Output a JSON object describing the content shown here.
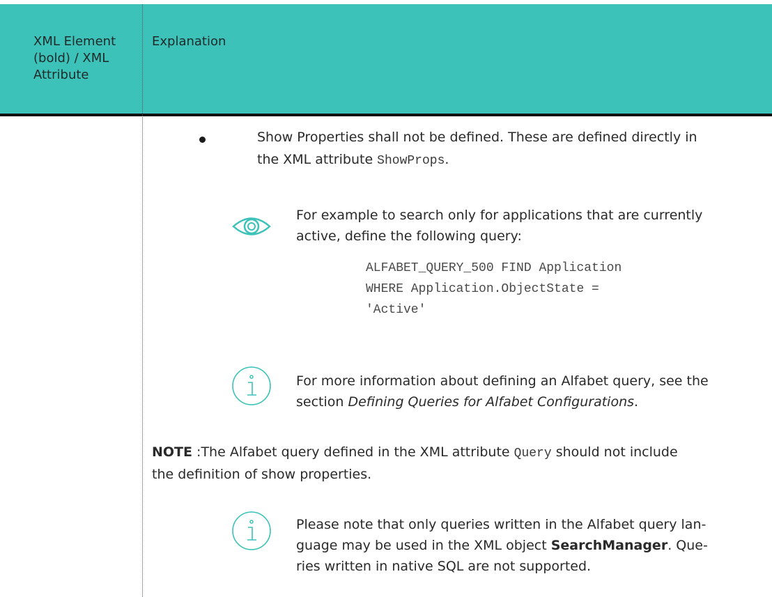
{
  "header": {
    "col1": "XML Element (bold) / XML Attribute",
    "col2": "Explanation"
  },
  "bullet": {
    "line1": "Show Properties shall not be defined. These are defined directly in",
    "line2_pre": "the XML attribute ",
    "line2_code": "ShowProps",
    "line2_post": "."
  },
  "example": {
    "icon": "eye-icon",
    "line1": "For example to search only for applications that are currently",
    "line2": "active, define the following query:",
    "code": [
      "ALFABET_QUERY_500 FIND Application",
      "WHERE Application.ObjectState =",
      "'Active'"
    ]
  },
  "info1": {
    "icon": "info-icon",
    "line1": "For more information about defining an Alfabet query, see the",
    "line2_pre": "section ",
    "line2_italic": "Defining Queries for Alfabet Configurations",
    "line2_post": "."
  },
  "note": {
    "label": "NOTE",
    "line1_pre": " :The Alfabet query defined in the XML attribute ",
    "line1_code": "Query",
    "line1_post": " should not include",
    "line2": "the definition of show properties."
  },
  "info2": {
    "icon": "info-icon",
    "line1": "Please note that only queries written in the Alfabet query lan-",
    "line2_pre": "guage may be used in the XML object ",
    "line2_bold": "SearchManager",
    "line2_post": ". Que-",
    "line3": "ries written in native SQL are not supported."
  },
  "colors": {
    "header_bg": "#3cc2b8",
    "icon": "#3cc2b8"
  }
}
